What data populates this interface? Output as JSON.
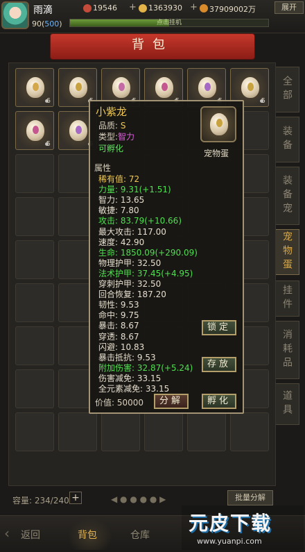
{
  "header": {
    "player_name": "雨滴",
    "currency_1": "19546",
    "currency_2": "1363930",
    "currency_3": "37909002万",
    "expand_label": "展开",
    "level_prefix": "90(",
    "level_value": "500",
    "level_suffix": ")",
    "exp_label": "点击挂机",
    "exp_fraction": 0.5
  },
  "banner": {
    "title": "背包"
  },
  "side_tabs": [
    {
      "label": "全部",
      "active": false
    },
    {
      "label": "装备",
      "active": false
    },
    {
      "label": "装备宠",
      "active": false
    },
    {
      "label": "宠物蛋",
      "active": true
    },
    {
      "label": "挂件",
      "active": false
    },
    {
      "label": "消耗品",
      "active": false
    },
    {
      "label": "道具",
      "active": false
    }
  ],
  "slots": [
    {
      "count": "6",
      "mark_color": "#d4a74a"
    },
    {
      "count": "5",
      "mark_color": "#c7a23e"
    },
    {
      "count": "5",
      "mark_color": "#c46aa6"
    },
    {
      "count": "5",
      "mark_color": "#c4578f"
    },
    {
      "count": "5",
      "mark_color": "#a66ac4"
    },
    {
      "count": "5",
      "mark_color": "#c7a23e"
    },
    {
      "count": "5",
      "mark_color": "#c4578f"
    },
    {
      "count": "5",
      "mark_color": "#a66ac4"
    }
  ],
  "tooltip": {
    "name": "小紫龙",
    "quality_label": "品质:",
    "quality_value": "S",
    "type_label": "类型:",
    "type_value": "智力",
    "hatchable": "可孵化",
    "icon_label": "宠物蛋",
    "attr_header": "属性",
    "stats": [
      {
        "label": "稀有值:",
        "value": "72",
        "color": "yellow"
      },
      {
        "label": "力量:",
        "value": "9.31(+1.51)",
        "color": "green"
      },
      {
        "label": "智力:",
        "value": "13.65",
        "color": "white"
      },
      {
        "label": "敏捷:",
        "value": "7.80",
        "color": "white"
      },
      {
        "label": "攻击:",
        "value": "83.79(+10.66)",
        "color": "green"
      },
      {
        "label": "最大攻击:",
        "value": "117.00",
        "color": "white"
      },
      {
        "label": "速度:",
        "value": "42.90",
        "color": "white"
      },
      {
        "label": "生命:",
        "value": "1850.09(+290.09)",
        "color": "green"
      },
      {
        "label": "物理护甲:",
        "value": "32.50",
        "color": "white"
      },
      {
        "label": "法术护甲:",
        "value": "37.45(+4.95)",
        "color": "green"
      },
      {
        "label": "穿刺护甲:",
        "value": "32.50",
        "color": "white"
      },
      {
        "label": "回合恢复:",
        "value": "187.20",
        "color": "white"
      },
      {
        "label": "韧性:",
        "value": "9.53",
        "color": "white"
      },
      {
        "label": "命中:",
        "value": "9.75",
        "color": "white"
      },
      {
        "label": "暴击:",
        "value": "8.67",
        "color": "white"
      },
      {
        "label": "穿透:",
        "value": "8.67",
        "color": "white"
      },
      {
        "label": "闪避:",
        "value": "10.83",
        "color": "white"
      },
      {
        "label": "暴击抵抗:",
        "value": "9.53",
        "color": "white"
      },
      {
        "label": "附加伤害:",
        "value": "32.87(+5.24)",
        "color": "green"
      },
      {
        "label": "伤害减免:",
        "value": "33.15",
        "color": "white"
      },
      {
        "label": "全元素减免:",
        "value": "33.15",
        "color": "white"
      }
    ],
    "price_label": "价值:",
    "price_value": "50000",
    "buttons": {
      "lock": "锁定",
      "store": "存放",
      "decompose": "分解",
      "hatch": "孵化"
    }
  },
  "footer": {
    "capacity_label": "容量:",
    "capacity_value": "234/240",
    "batch_label": "批量分解",
    "nav": [
      {
        "label": "返回",
        "active": false
      },
      {
        "label": "背包",
        "active": true
      },
      {
        "label": "仓库",
        "active": false
      }
    ]
  },
  "watermark": {
    "main": "元皮下载",
    "url": "www.yuanpi.com"
  }
}
